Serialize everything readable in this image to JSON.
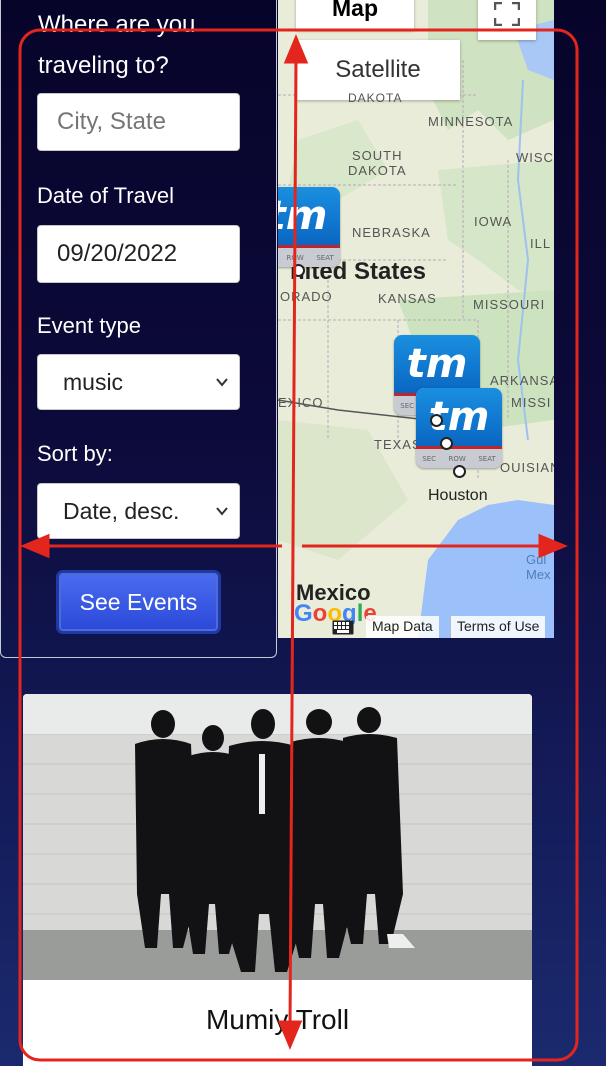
{
  "form": {
    "question": "Where are you traveling to?",
    "city_placeholder": "City, State",
    "date_label": "Date of Travel",
    "date_value": "09/20/2022",
    "event_type_label": "Event type",
    "event_type_value": "music",
    "sort_label": "Sort by:",
    "sort_value": "Date, desc.",
    "submit_label": "See Events"
  },
  "map": {
    "map_type_map": "Map",
    "map_type_satellite": "Satellite",
    "labels": {
      "dakota": "DAKOTA",
      "minnesota": "MINNESOTA",
      "wisc": "WISC",
      "south_dakota_1": "SOUTH",
      "south_dakota_2": "DAKOTA",
      "nebraska": "NEBRASKA",
      "iowa": "IOWA",
      "ill": "ILL",
      "united_states": "nited States",
      "orado": "ORADO",
      "kansas": "KANSAS",
      "missouri": "MISSOURI",
      "arkansas": "ARKANSAS",
      "missi": "MISSI",
      "mexico_small": "EXICO",
      "texas": "TEXAS",
      "louisian": "OUISIAN",
      "houston": "Houston",
      "mexico": "Mexico",
      "gulf_1": "Gul",
      "gulf_2": "Mex"
    },
    "pin_text": "tm",
    "pin_seat": [
      "SEC",
      "ROW",
      "SEAT"
    ],
    "google": [
      "G",
      "o",
      "o",
      "g",
      "l",
      "e"
    ],
    "map_data_link": "Map Data",
    "terms_link": "Terms of Use",
    "colors": {
      "land": "#e9ecd9",
      "water": "#9cc0f9",
      "green": "#cde3c0"
    }
  },
  "event": {
    "title": "Mumiy Troll"
  },
  "colors": {
    "accent": "#2b49d8",
    "annotation": "#e3261d"
  }
}
